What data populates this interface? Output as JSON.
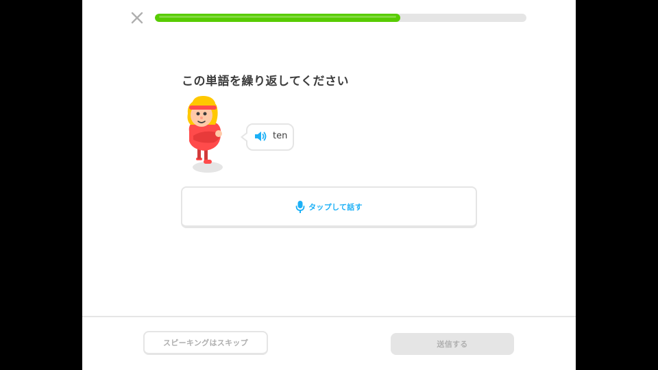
{
  "header": {
    "close_icon": "close-icon",
    "progress_fraction": 0.66,
    "progress_color": "#58cc02",
    "track_color": "#e5e5e5"
  },
  "prompt": {
    "title": "この単語を繰り返してください"
  },
  "bubble": {
    "icon": "speaker-icon",
    "word": "ten"
  },
  "tap_to_speak": {
    "icon": "microphone-icon",
    "label": "タップして話す",
    "color": "#1cb0f6"
  },
  "footer": {
    "skip_label": "スピーキングはスキップ",
    "send_label": "送信する"
  }
}
